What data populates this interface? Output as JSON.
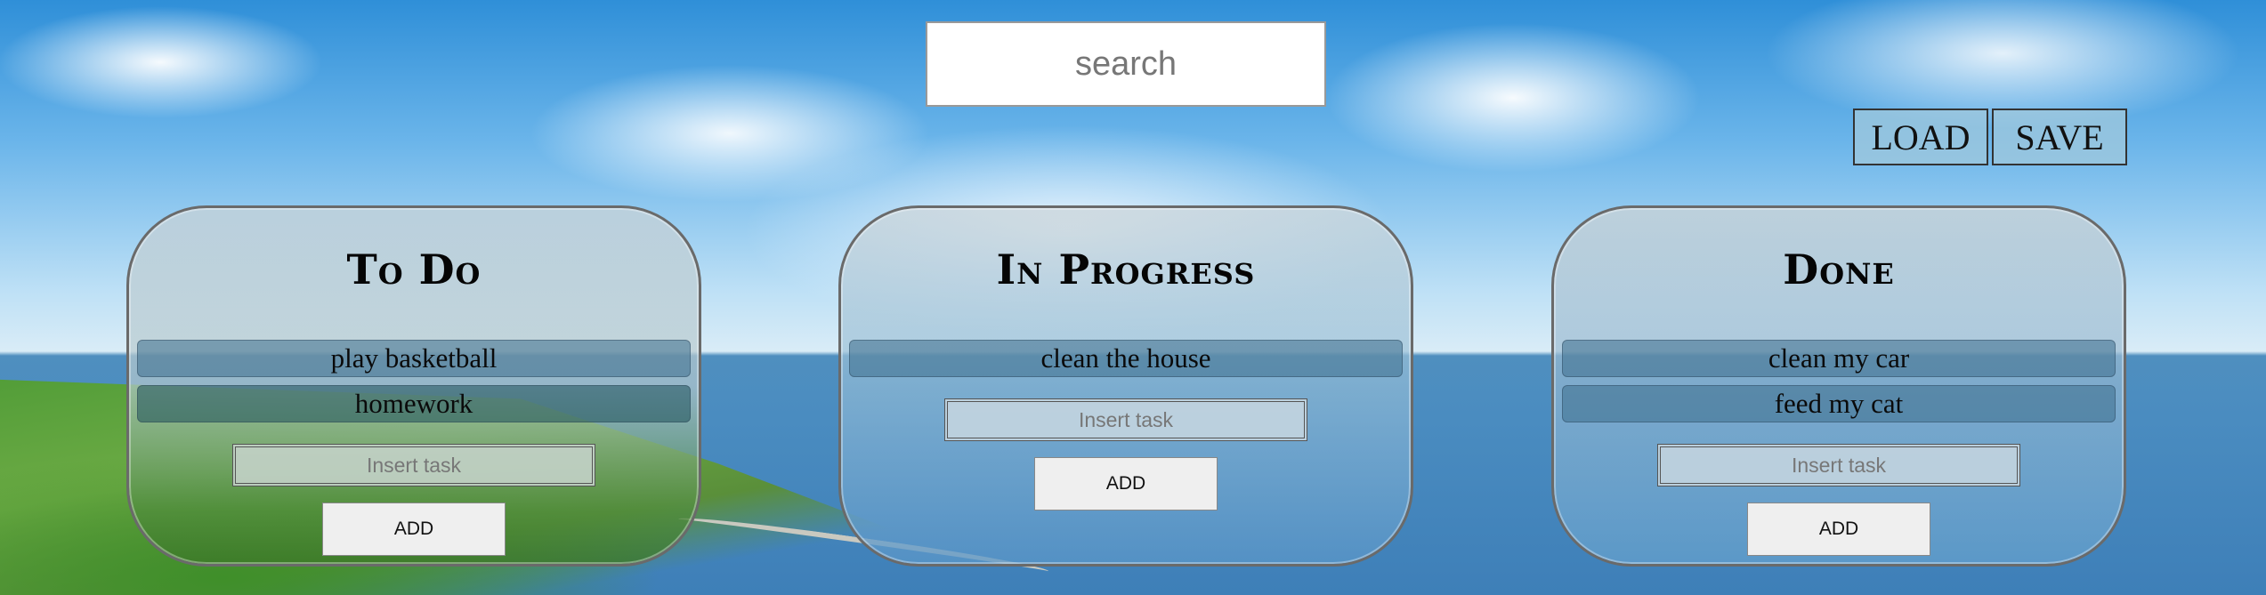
{
  "search": {
    "placeholder": "search"
  },
  "storage": {
    "load_label": "LOAD",
    "save_label": "SAVE"
  },
  "columns": [
    {
      "title": "To Do",
      "tasks": [
        "play basketball",
        "homework"
      ],
      "input_placeholder": "Insert task",
      "add_label": "ADD"
    },
    {
      "title": "In Progress",
      "tasks": [
        "clean the house"
      ],
      "input_placeholder": "Insert task",
      "add_label": "ADD"
    },
    {
      "title": "Done",
      "tasks": [
        "clean my car",
        "feed my cat"
      ],
      "input_placeholder": "Insert task",
      "add_label": "ADD"
    }
  ]
}
